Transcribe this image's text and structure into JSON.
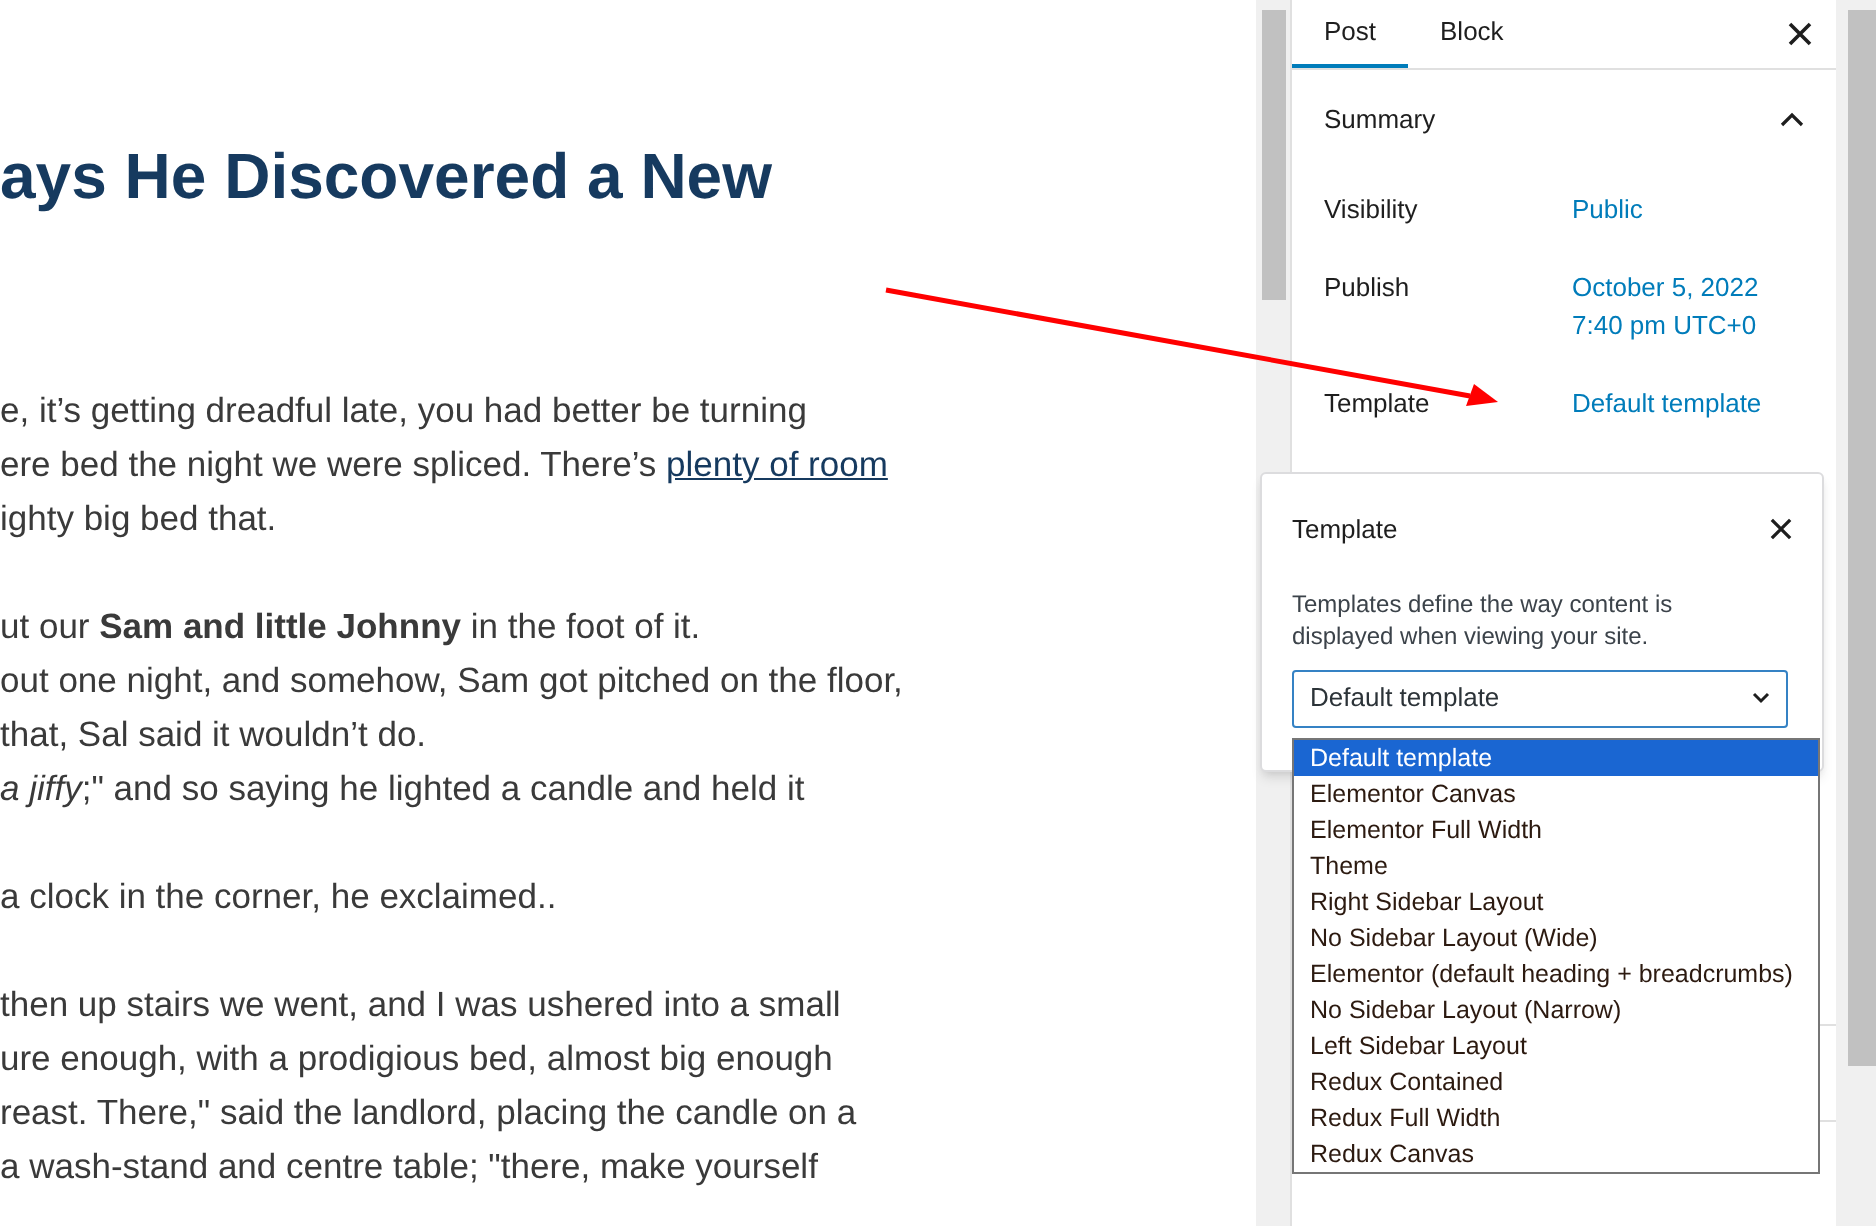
{
  "editor": {
    "title": "ays He Discovered a New",
    "paragraphs": [
      [
        {
          "text": "e, it’s getting dreadful late, you had better be turning"
        },
        {
          "text": "ere bed the night we were spliced. There’s ",
          "link": "plenty of room"
        },
        {
          "text": "ighty big bed that."
        }
      ],
      [
        {
          "text": "ut our **Sam and little Johnny** in the foot of it."
        },
        {
          "text": "out one night, and somehow, Sam got pitched on the floor,"
        },
        {
          "text": "that, Sal said it wouldn’t do."
        },
        {
          "text": "*a jiffy*;\" and so saying he lighted a candle and held it"
        }
      ],
      [
        {
          "text": "a clock in the corner, he exclaimed.."
        }
      ],
      [
        {
          "text": "then up stairs we went, and I was ushered into a small"
        },
        {
          "text": "ure enough, with a prodigious bed, almost big enough"
        },
        {
          "text": "reast. There,\" said the landlord, placing the candle on a"
        },
        {
          "text": "a wash-stand and centre table; \"there, make yourself"
        }
      ]
    ]
  },
  "sidebar": {
    "tabs": [
      {
        "label": "Post",
        "selected": true
      },
      {
        "label": "Block",
        "selected": false
      }
    ],
    "summary": {
      "title": "Summary",
      "expanded": true,
      "rows": [
        {
          "label": "Visibility",
          "values": [
            "Public"
          ]
        },
        {
          "label": "Publish",
          "values": [
            "October 5, 2022",
            "7:40 pm UTC+0"
          ]
        },
        {
          "label": "Template",
          "values": [
            "Default template"
          ]
        }
      ]
    }
  },
  "template_popover": {
    "title": "Template",
    "description": "Templates define the way content is displayed when viewing your site.",
    "select": {
      "value": "Default template",
      "expanded": true,
      "options": [
        {
          "label": "Default template",
          "selected": true
        },
        {
          "label": "Elementor Canvas",
          "selected": false
        },
        {
          "label": "Elementor Full Width",
          "selected": false
        },
        {
          "label": "Theme",
          "selected": false
        },
        {
          "label": "Right Sidebar Layout",
          "selected": false
        },
        {
          "label": "No Sidebar Layout (Wide)",
          "selected": false
        },
        {
          "label": "Elementor (default heading + breadcrumbs)",
          "selected": false
        },
        {
          "label": "No Sidebar Layout (Narrow)",
          "selected": false
        },
        {
          "label": "Left Sidebar Layout",
          "selected": false
        },
        {
          "label": "Redux Contained",
          "selected": false
        },
        {
          "label": "Redux Full Width",
          "selected": false
        },
        {
          "label": "Redux Canvas",
          "selected": false
        }
      ]
    }
  }
}
